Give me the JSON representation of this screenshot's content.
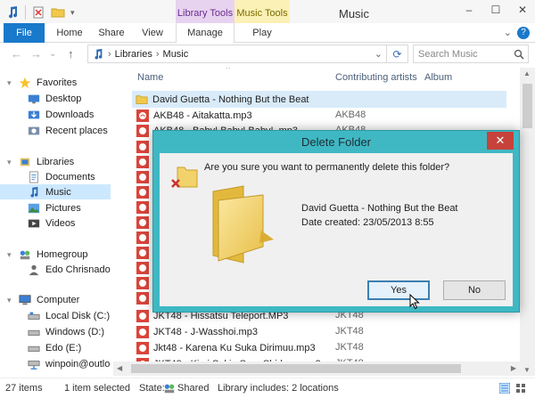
{
  "window": {
    "title": "Music",
    "context_tabs": {
      "library_tools": "Library Tools",
      "music_tools": "Music Tools"
    },
    "controls": {
      "minimize": "–",
      "maximize": "☐",
      "close": "✕"
    }
  },
  "ribbon": {
    "tabs": [
      "File",
      "Home",
      "Share",
      "View",
      "Manage",
      "Play"
    ],
    "expand": "⌄",
    "help": "?"
  },
  "address": {
    "nav_back": "←",
    "nav_forward": "→",
    "nav_history": "⌄",
    "nav_up": "↑",
    "path": [
      "Libraries",
      "Music"
    ],
    "separator": "›",
    "dropdown": "⌄",
    "refresh": "⟳",
    "search_placeholder": "Search Music",
    "search_icon": "search-icon"
  },
  "nav_pane": {
    "items": [
      {
        "label": "Favorites"
      },
      {
        "label": "Desktop"
      },
      {
        "label": "Downloads"
      },
      {
        "label": "Recent places"
      },
      {
        "label": "Libraries"
      },
      {
        "label": "Documents"
      },
      {
        "label": "Music"
      },
      {
        "label": "Pictures"
      },
      {
        "label": "Videos"
      },
      {
        "label": "Homegroup"
      },
      {
        "label": "Edo Chrisnado"
      },
      {
        "label": "Computer"
      },
      {
        "label": "Local Disk (C:)"
      },
      {
        "label": "Windows (D:)"
      },
      {
        "label": "Edo (E:)"
      },
      {
        "label": "winpoin@outlo"
      }
    ]
  },
  "columns": {
    "name": "Name",
    "artist": "Contributing artists",
    "album": "Album"
  },
  "files": [
    {
      "name": "David Guetta - Nothing But the Beat",
      "artist": ""
    },
    {
      "name": "AKB48 - Aitakatta.mp3",
      "artist": "AKB48"
    },
    {
      "name": "AKB48 - Baby! Baby! Baby! .mp3",
      "artist": "AKB48"
    },
    {
      "name": "JKT48 - Hissatsu Teleport.MP3",
      "artist": "JKT48"
    },
    {
      "name": "JKT48 - J-Wasshoi.mp3",
      "artist": "JKT48"
    },
    {
      "name": "Jkt48 - Karena Ku Suka Dirimuu.mp3",
      "artist": "JKT48"
    },
    {
      "name": "JKT48 - Kimi Sukia Sore Shiden...mp3",
      "artist": "JKT48"
    }
  ],
  "status": {
    "count": "27 items",
    "selected": "1 item selected",
    "state_label": "State:",
    "state_value": "Shared",
    "library": "Library includes: 2 locations"
  },
  "dialog": {
    "title": "Delete Folder",
    "close": "✕",
    "question": "Are you sure you want to permanently delete this folder?",
    "folder_name": "David Guetta - Nothing But the Beat",
    "date_created": "Date created: 23/05/2013 8:55",
    "yes": "Yes",
    "no": "No"
  }
}
